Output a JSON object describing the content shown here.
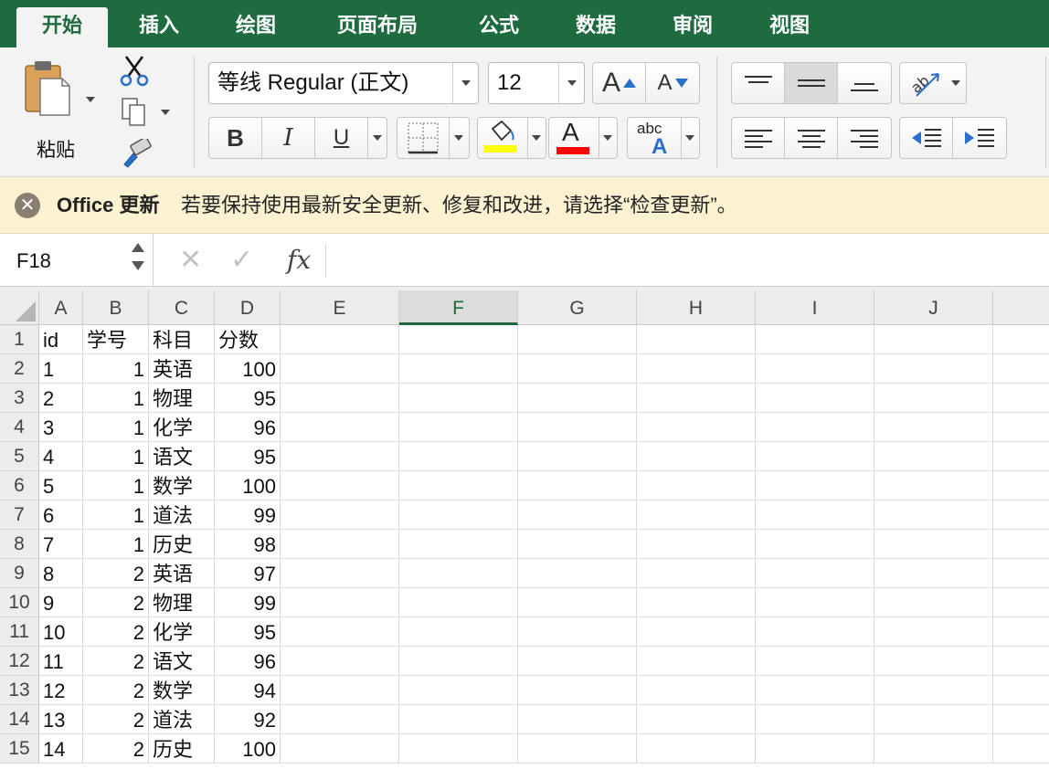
{
  "ribbon_tabs": [
    {
      "label": "开始",
      "active": true
    },
    {
      "label": "插入"
    },
    {
      "label": "绘图"
    },
    {
      "label": "页面布局"
    },
    {
      "label": "公式"
    },
    {
      "label": "数据"
    },
    {
      "label": "审阅"
    },
    {
      "label": "视图"
    }
  ],
  "clipboard": {
    "paste_label": "粘贴",
    "icons": [
      "paste-icon",
      "scissors-icon",
      "copy-icon",
      "format-painter-icon"
    ]
  },
  "font": {
    "name": "等线 Regular (正文)",
    "size": "12",
    "increase_label": "A",
    "decrease_label": "A",
    "bold_label": "B",
    "italic_label": "I",
    "underline_label": "U",
    "fill_color": "#ffff00",
    "font_color": "#ff0000",
    "font_color_label": "A",
    "phonetic_label_top": "abc",
    "phonetic_label_bottom": "A"
  },
  "notification": {
    "title": "Office 更新",
    "message": "若要保持使用最新安全更新、修复和改进，请选择“检查更新”。",
    "icon": "close-circle-icon"
  },
  "formula_bar": {
    "name_box": "F18",
    "fx_label": "fx",
    "cancel_glyph": "✕",
    "confirm_glyph": "✓",
    "formula": ""
  },
  "sheet": {
    "selected_column": "F",
    "columns": [
      "A",
      "B",
      "C",
      "D",
      "E",
      "F",
      "G",
      "H",
      "I",
      "J"
    ],
    "row_numbers": [
      "1",
      "2",
      "3",
      "4",
      "5",
      "6",
      "7",
      "8",
      "9",
      "10",
      "11",
      "12",
      "13",
      "14",
      "15"
    ],
    "rows": [
      [
        "id",
        "学号",
        "科目",
        "分数"
      ],
      [
        "1",
        "1",
        "英语",
        "100"
      ],
      [
        "2",
        "1",
        "物理",
        "95"
      ],
      [
        "3",
        "1",
        "化学",
        "96"
      ],
      [
        "4",
        "1",
        "语文",
        "95"
      ],
      [
        "5",
        "1",
        "数学",
        "100"
      ],
      [
        "6",
        "1",
        "道法",
        "99"
      ],
      [
        "7",
        "1",
        "历史",
        "98"
      ],
      [
        "8",
        "2",
        "英语",
        "97"
      ],
      [
        "9",
        "2",
        "物理",
        "99"
      ],
      [
        "10",
        "2",
        "化学",
        "95"
      ],
      [
        "11",
        "2",
        "语文",
        "96"
      ],
      [
        "12",
        "2",
        "数学",
        "94"
      ],
      [
        "13",
        "2",
        "道法",
        "92"
      ],
      [
        "14",
        "2",
        "历史",
        "100"
      ]
    ]
  },
  "colors": {
    "accent": "#1e6b40",
    "notification_bg": "#fcf2d1"
  }
}
